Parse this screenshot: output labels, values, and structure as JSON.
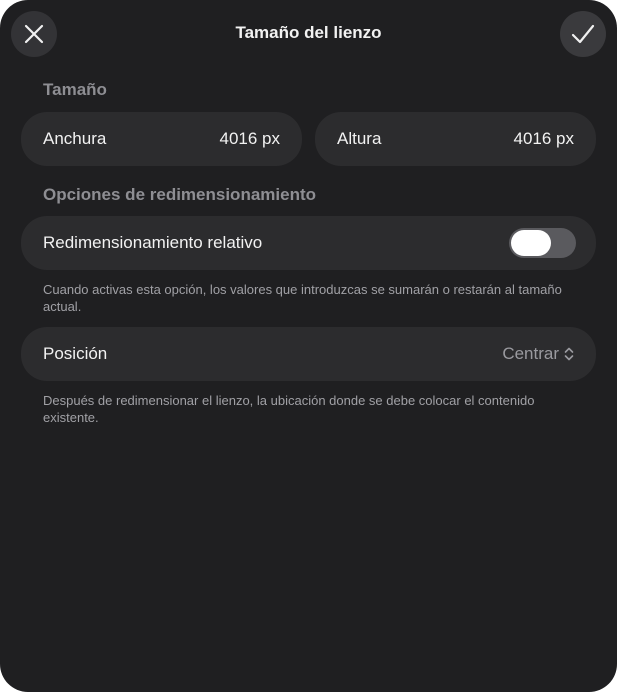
{
  "header": {
    "title": "Tamaño del lienzo",
    "close_icon": "close-icon",
    "confirm_icon": "checkmark-icon"
  },
  "size_section": {
    "label": "Tamaño",
    "width": {
      "label": "Anchura",
      "value": "4016 px"
    },
    "height": {
      "label": "Altura",
      "value": "4016 px"
    }
  },
  "resize_section": {
    "label": "Opciones de redimensionamiento",
    "relative": {
      "label": "Redimensionamiento relativo",
      "enabled": false,
      "hint": "Cuando activas esta opción, los valores que introduzcas se sumarán o restarán al tamaño actual."
    },
    "position": {
      "label": "Posición",
      "value": "Centrar",
      "icon": "chevron-up-down-icon",
      "hint": "Después de redimensionar el lienzo, la ubicación donde se debe colocar el contenido existente."
    }
  },
  "colors": {
    "background": "#1f1f21",
    "card": "#2c2c2e",
    "secondary_text": "#8e8e93"
  }
}
